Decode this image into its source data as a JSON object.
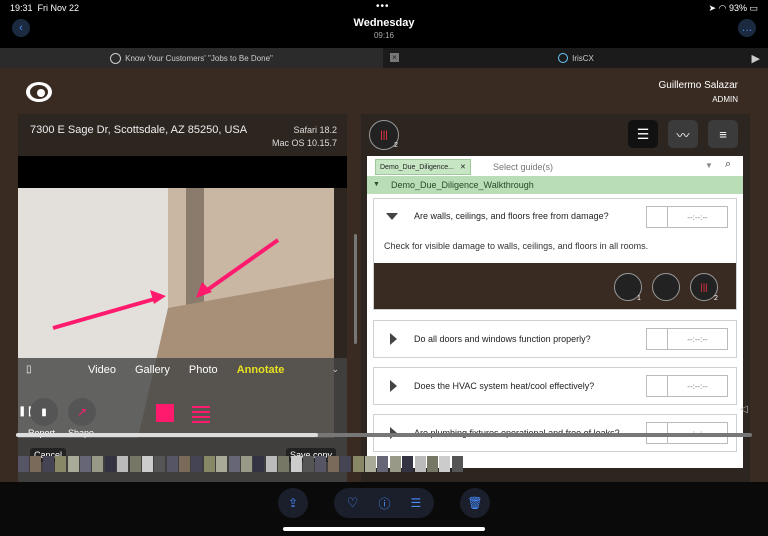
{
  "status": {
    "time": "19:31",
    "date": "Fri Nov 22",
    "battery": "93%"
  },
  "header": {
    "title": "Wednesday",
    "subtitle": "09:16"
  },
  "tabs": {
    "tab1": "Know Your Customers' \"Jobs to Be Done\"",
    "tab2": "IrisCX"
  },
  "user": {
    "name": "Guillermo Salazar",
    "role": "ADMIN"
  },
  "session": {
    "address": "7300 E Sage Dr, Scottsdale, AZ 85250, USA",
    "browser": "Safari 18.2",
    "os": "Mac OS 10.15.7"
  },
  "ai_badge": {
    "label": "AI",
    "count": "2"
  },
  "guide": {
    "chip": "Demo_Due_Diligence...",
    "placeholder": "Select guide(s)",
    "name": "Demo_Due_Diligence_Walkthrough",
    "questions": [
      {
        "text": "Are walls, ceilings, and floors free from damage?",
        "time": "--:--:--",
        "detail": "Check for visible damage to walls, ceilings, and floors in all rooms."
      },
      {
        "text": "Do all doors and windows function properly?",
        "time": "--:--:--"
      },
      {
        "text": "Does the HVAC system heat/cool effectively?",
        "time": "--:--:--"
      },
      {
        "text": "Are plumbing fixtures operational and free of leaks?",
        "time": "--:--:--"
      }
    ],
    "image_count": "1",
    "ai_count": "2"
  },
  "overlay": {
    "tabs": [
      "Video",
      "Gallery",
      "Photo",
      "Annotate"
    ],
    "report": "Report",
    "shape": "Shape",
    "cancel": "Cancel",
    "save": "Save copy"
  },
  "colors": {
    "accent_pink": "#ff1a6e",
    "green_header": "#b9ddb5",
    "brand_bg": "#3a2b22"
  },
  "progress": {
    "scrub_fraction": 0.41
  }
}
